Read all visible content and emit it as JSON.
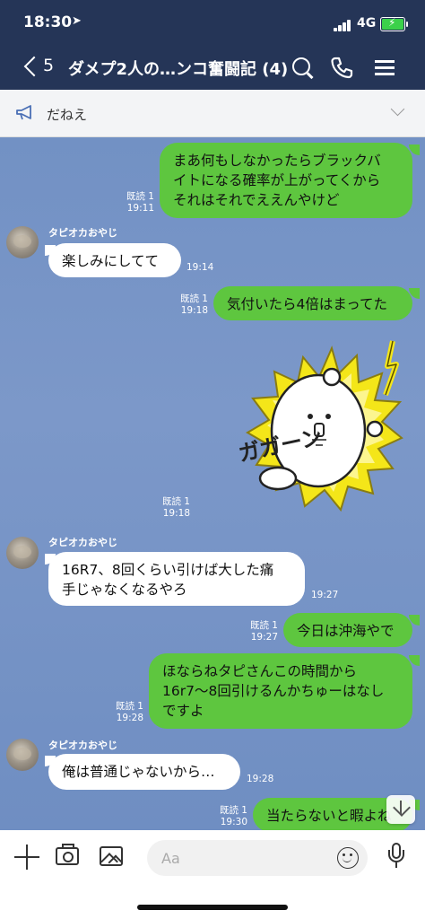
{
  "status_bar": {
    "time": "18:30",
    "network": "4G"
  },
  "header": {
    "back_count": "5",
    "title": "ダメプ2人の…ンコ奮闘記 (4)"
  },
  "announcement": {
    "text": "だねえ"
  },
  "messages": [
    {
      "sender": "me",
      "lines": [
        "まあ何もしなかったらブラックバ",
        "イトになる確率が上がってくから",
        "それはそれでええんやけど"
      ],
      "read": "既読 1",
      "time": "19:11"
    },
    {
      "sender": "them",
      "name": "タピオカおやじ",
      "lines": [
        "楽しみにしてて"
      ],
      "time": "19:14"
    },
    {
      "sender": "me",
      "lines": [
        "気付いたら4倍はまってた"
      ],
      "read": "既読 1",
      "time": "19:18"
    },
    {
      "sender": "me",
      "sticker": "shocked-bear-sticker",
      "sticker_text": "ガガーン",
      "read": "既読 1",
      "time": "19:18"
    },
    {
      "sender": "them",
      "name": "タピオカおやじ",
      "lines": [
        "16R7、8回くらい引けば大した痛",
        "手じゃなくなるやろ"
      ],
      "time": "19:27"
    },
    {
      "sender": "me",
      "lines": [
        "今日は沖海やで"
      ],
      "read": "既読 1",
      "time": "19:27"
    },
    {
      "sender": "me",
      "lines": [
        "ほならねタピさんこの時間から",
        "16r7〜8回引けるんかちゅーはなし",
        "ですよ"
      ],
      "read": "既読 1",
      "time": "19:28"
    },
    {
      "sender": "them",
      "name": "タピオカおやじ",
      "lines": [
        "俺は普通じゃないから…"
      ],
      "time": "19:28"
    },
    {
      "sender": "me",
      "lines": [
        "当たらないと暇よね"
      ],
      "read": "既読 1",
      "time": "19:30"
    }
  ],
  "input": {
    "placeholder": "Aa"
  },
  "colors": {
    "header_bg": "#253557",
    "my_bubble": "#5ec63f",
    "chat_bg": "#7291c4"
  }
}
